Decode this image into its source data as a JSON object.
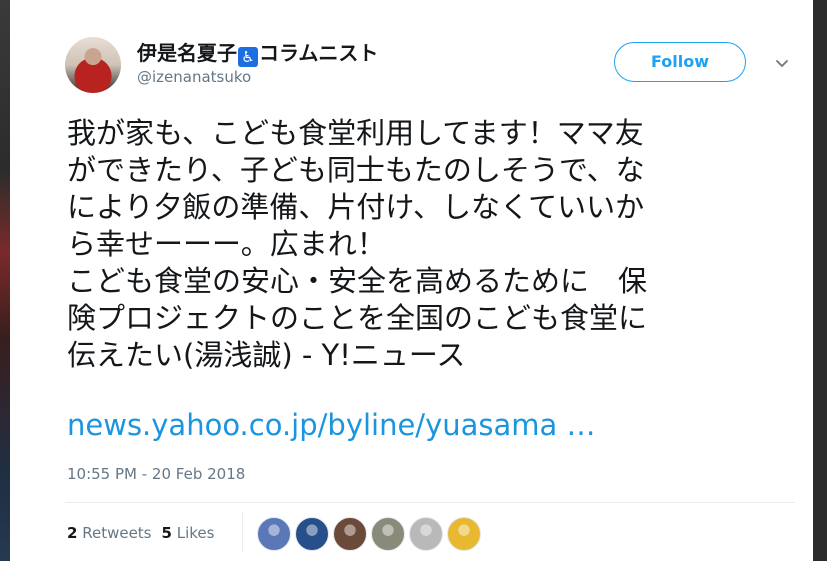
{
  "author": {
    "name_prefix": "伊是名夏子",
    "wheelchair_glyph": "♿",
    "name_suffix": "コラムニスト",
    "handle": "@izenanatsuko"
  },
  "follow_button": {
    "label": "Follow"
  },
  "tweet": {
    "lines": [
      "我が家も、こども食堂利用してます！ママ友",
      "ができたり、子ども同士もたのしそうで、な",
      "により夕飯の準備、片付け、しなくていいか",
      "ら幸せーーー。広まれ！",
      "こども食堂の安心・安全を高めるために　保",
      "険プロジェクトのことを全国のこども食堂に",
      "伝えたい(湯浅誠) - Y!ニュース"
    ],
    "link": "news.yahoo.co.jp/byline/yuasama …",
    "timestamp": "10:55 PM - 20 Feb 2018"
  },
  "stats": {
    "retweets_count": "2",
    "retweets_label": "Retweets",
    "likes_count": "5",
    "likes_label": "Likes"
  },
  "colors": {
    "accent": "#1da1f2",
    "link": "#1b95e0",
    "muted": "#657786",
    "text": "#14171a"
  },
  "liker_avatars": [
    {
      "name": "liker-1",
      "bg": "#5a78b8"
    },
    {
      "name": "liker-2",
      "bg": "#274f8a"
    },
    {
      "name": "liker-3",
      "bg": "#6b4a3a"
    },
    {
      "name": "liker-4",
      "bg": "#8a8a7a"
    },
    {
      "name": "liker-5",
      "bg": "#b9b9b9"
    },
    {
      "name": "liker-6",
      "bg": "#e8b830"
    }
  ]
}
